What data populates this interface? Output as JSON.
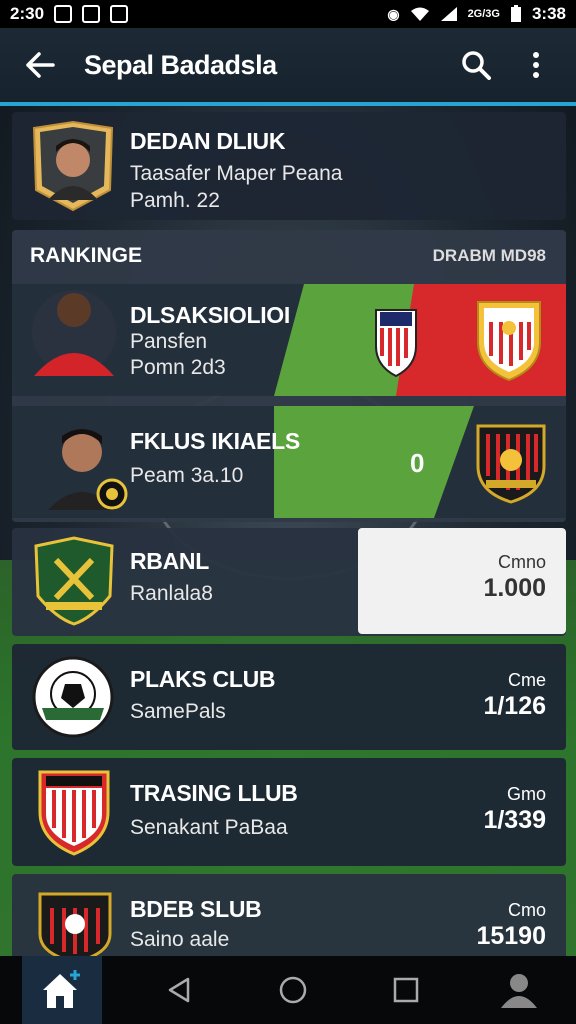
{
  "status_bar": {
    "time": "2:30",
    "signal_text": "2G/3G",
    "clock_right": "3:38"
  },
  "app_bar": {
    "title": "Sepal Badadsla"
  },
  "profile_card": {
    "name": "DEDAN DLIUK",
    "line1": "Taasafer Maper Peana",
    "line2": "Pamh. 22"
  },
  "ranking": {
    "header_left": "RANKINGE",
    "header_right": "DRABM MD98",
    "rows": [
      {
        "name": "DLSAKSIOLIOI",
        "line1": "Pansfen",
        "line2": "Pomn 2d3"
      },
      {
        "name": "FKLUS IKIAELS",
        "line1": "Peam 3a.10",
        "score": "0"
      }
    ]
  },
  "clubs": [
    {
      "name": "RBANL",
      "sub": "Ranlala8",
      "value_label": "Cmno",
      "value": "1.000"
    },
    {
      "name": "PLAKS CLUB",
      "sub": "SamePals",
      "value_label": "Cme",
      "value": "1/126"
    },
    {
      "name": "TRASING LLUB",
      "sub": "Senakant PaBaa",
      "value_label": "Gmo",
      "value": "1/339"
    },
    {
      "name": "BDEB SLUB",
      "sub": "Saino aale",
      "value_label": "Cmo",
      "value": "15190"
    }
  ],
  "colors": {
    "accent": "#27a3d4",
    "card": "#1e2634",
    "green": "#5aa33d",
    "red": "#d7282c"
  },
  "icons": [
    "back-arrow-icon",
    "search-icon",
    "more-vert-icon",
    "home-icon",
    "back-triangle-icon",
    "circle-home-icon",
    "square-recents-icon",
    "person-icon"
  ]
}
